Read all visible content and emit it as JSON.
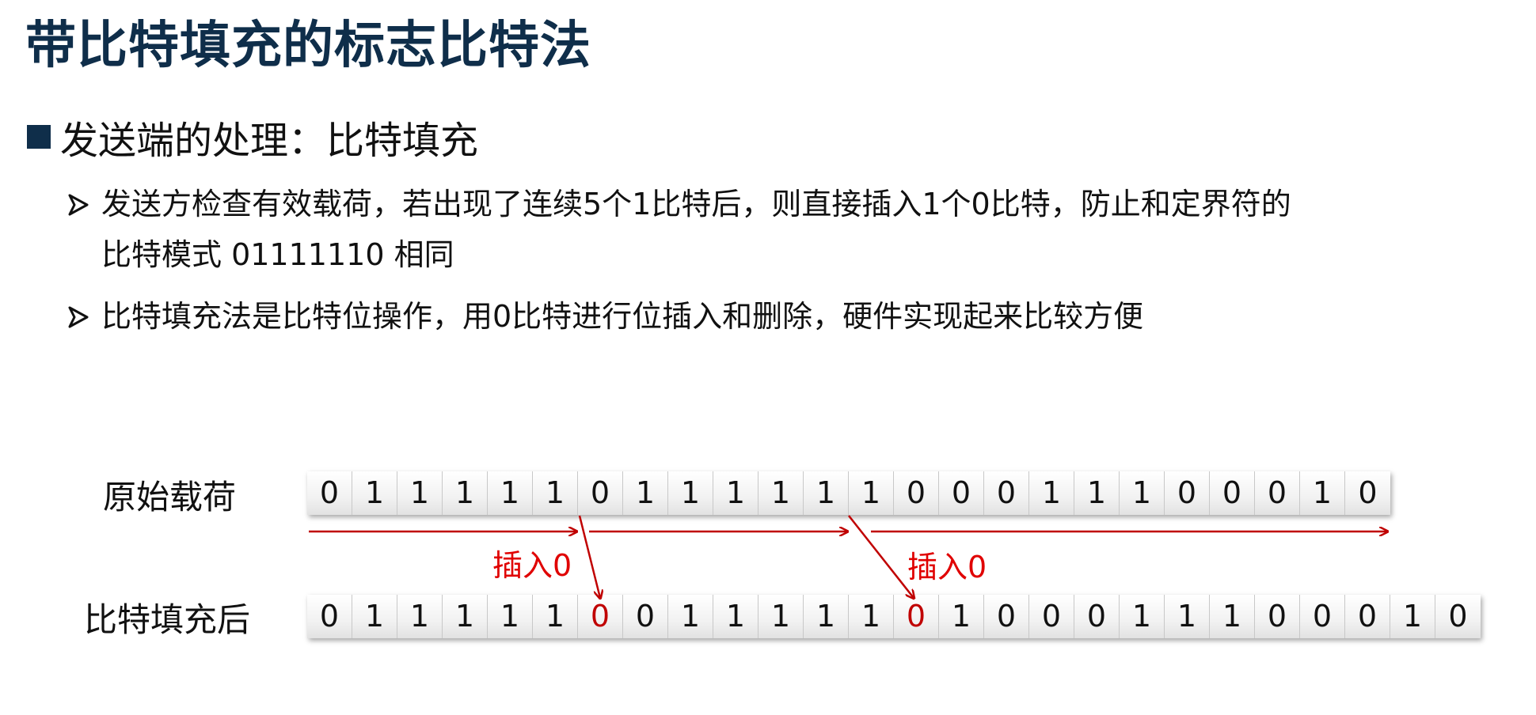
{
  "title": "带比特填充的标志比特法",
  "section": {
    "heading": "发送端的处理：比特填充"
  },
  "bullets": [
    {
      "line1": "发送方检查有效载荷，若出现了连续5个1比特后，则直接插入1个0比特，防止和定界符的",
      "line2": "比特模式 01111110 相同"
    },
    {
      "line1": "比特填充法是比特位操作，用0比特进行位插入和删除，硬件实现起来比较方便"
    }
  ],
  "diagram": {
    "original_label": "原始载荷",
    "stuffed_label": "比特填充后",
    "insert_label_1": "插入0",
    "insert_label_2": "插入0",
    "original_bits": [
      "0",
      "1",
      "1",
      "1",
      "1",
      "1",
      "0",
      "1",
      "1",
      "1",
      "1",
      "1",
      "1",
      "0",
      "0",
      "0",
      "1",
      "1",
      "1",
      "0",
      "0",
      "0",
      "1",
      "0"
    ],
    "stuffed_bits": [
      "0",
      "1",
      "1",
      "1",
      "1",
      "1",
      "0",
      "0",
      "1",
      "1",
      "1",
      "1",
      "1",
      "0",
      "1",
      "0",
      "0",
      "0",
      "1",
      "1",
      "1",
      "0",
      "0",
      "0",
      "1",
      "0"
    ],
    "inserted_positions": [
      6,
      13
    ],
    "colors": {
      "title": "#0f2e4a",
      "inserted_bit": "#c00000",
      "annotation": "#e00000",
      "arrow": "#c00000"
    }
  }
}
